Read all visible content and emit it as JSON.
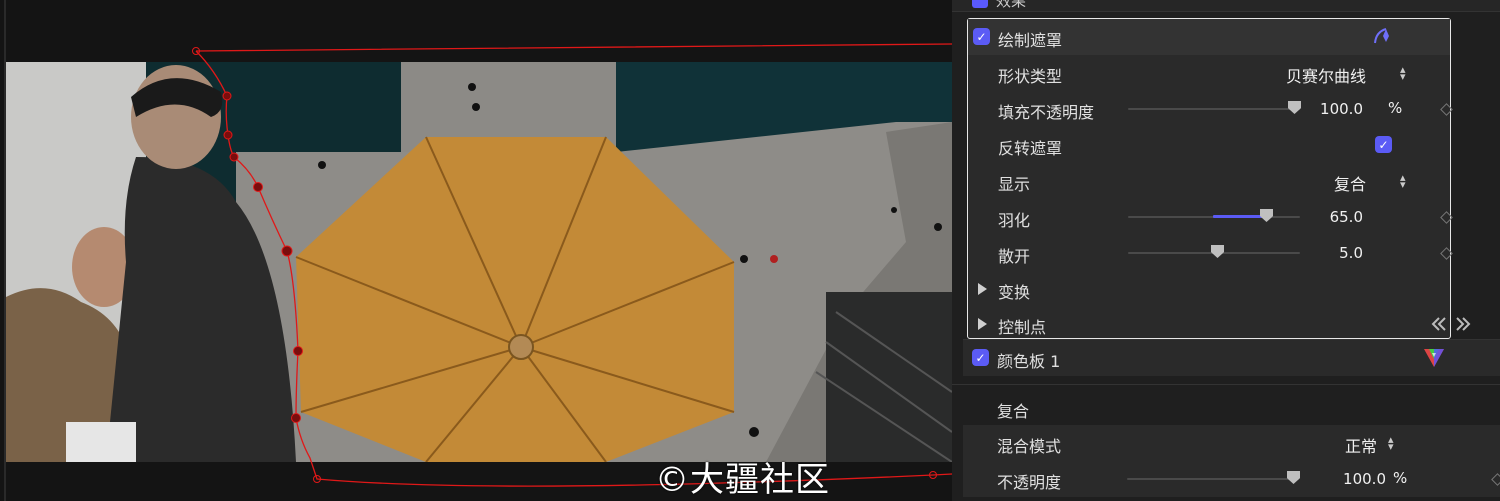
{
  "viewer": {
    "watermark": "©大疆社区"
  },
  "inspector": {
    "top_partial_label": "效果",
    "draw_mask": {
      "label": "绘制遮罩",
      "checked": true,
      "icon": "pen-tool-icon",
      "rows": {
        "shape_type": {
          "label": "形状类型",
          "value": "贝赛尔曲线"
        },
        "fill_opacity": {
          "label": "填充不透明度",
          "value": "100.0",
          "unit": "%",
          "level": 1.0
        },
        "invert_mask": {
          "label": "反转遮罩",
          "checked": true
        },
        "display": {
          "label": "显示",
          "value": "复合"
        },
        "feather": {
          "label": "羽化",
          "value": "65.0",
          "level": 0.65
        },
        "spread": {
          "label": "散开",
          "value": "5.0",
          "level": 0.5
        },
        "transform": {
          "label": "变换"
        },
        "control_points": {
          "label": "控制点"
        }
      }
    },
    "color_board": {
      "label": "颜色板 1",
      "checked": true,
      "icon": "color-board-icon"
    },
    "composite": {
      "title": "复合",
      "blend_mode": {
        "label": "混合模式",
        "value": "正常"
      },
      "opacity": {
        "label": "不透明度",
        "value": "100.0",
        "unit": "%",
        "level": 1.0
      }
    }
  },
  "colors": {
    "accent": "#5b5bf5",
    "mask_curve": "#e01818",
    "roof": "#c8923e"
  }
}
